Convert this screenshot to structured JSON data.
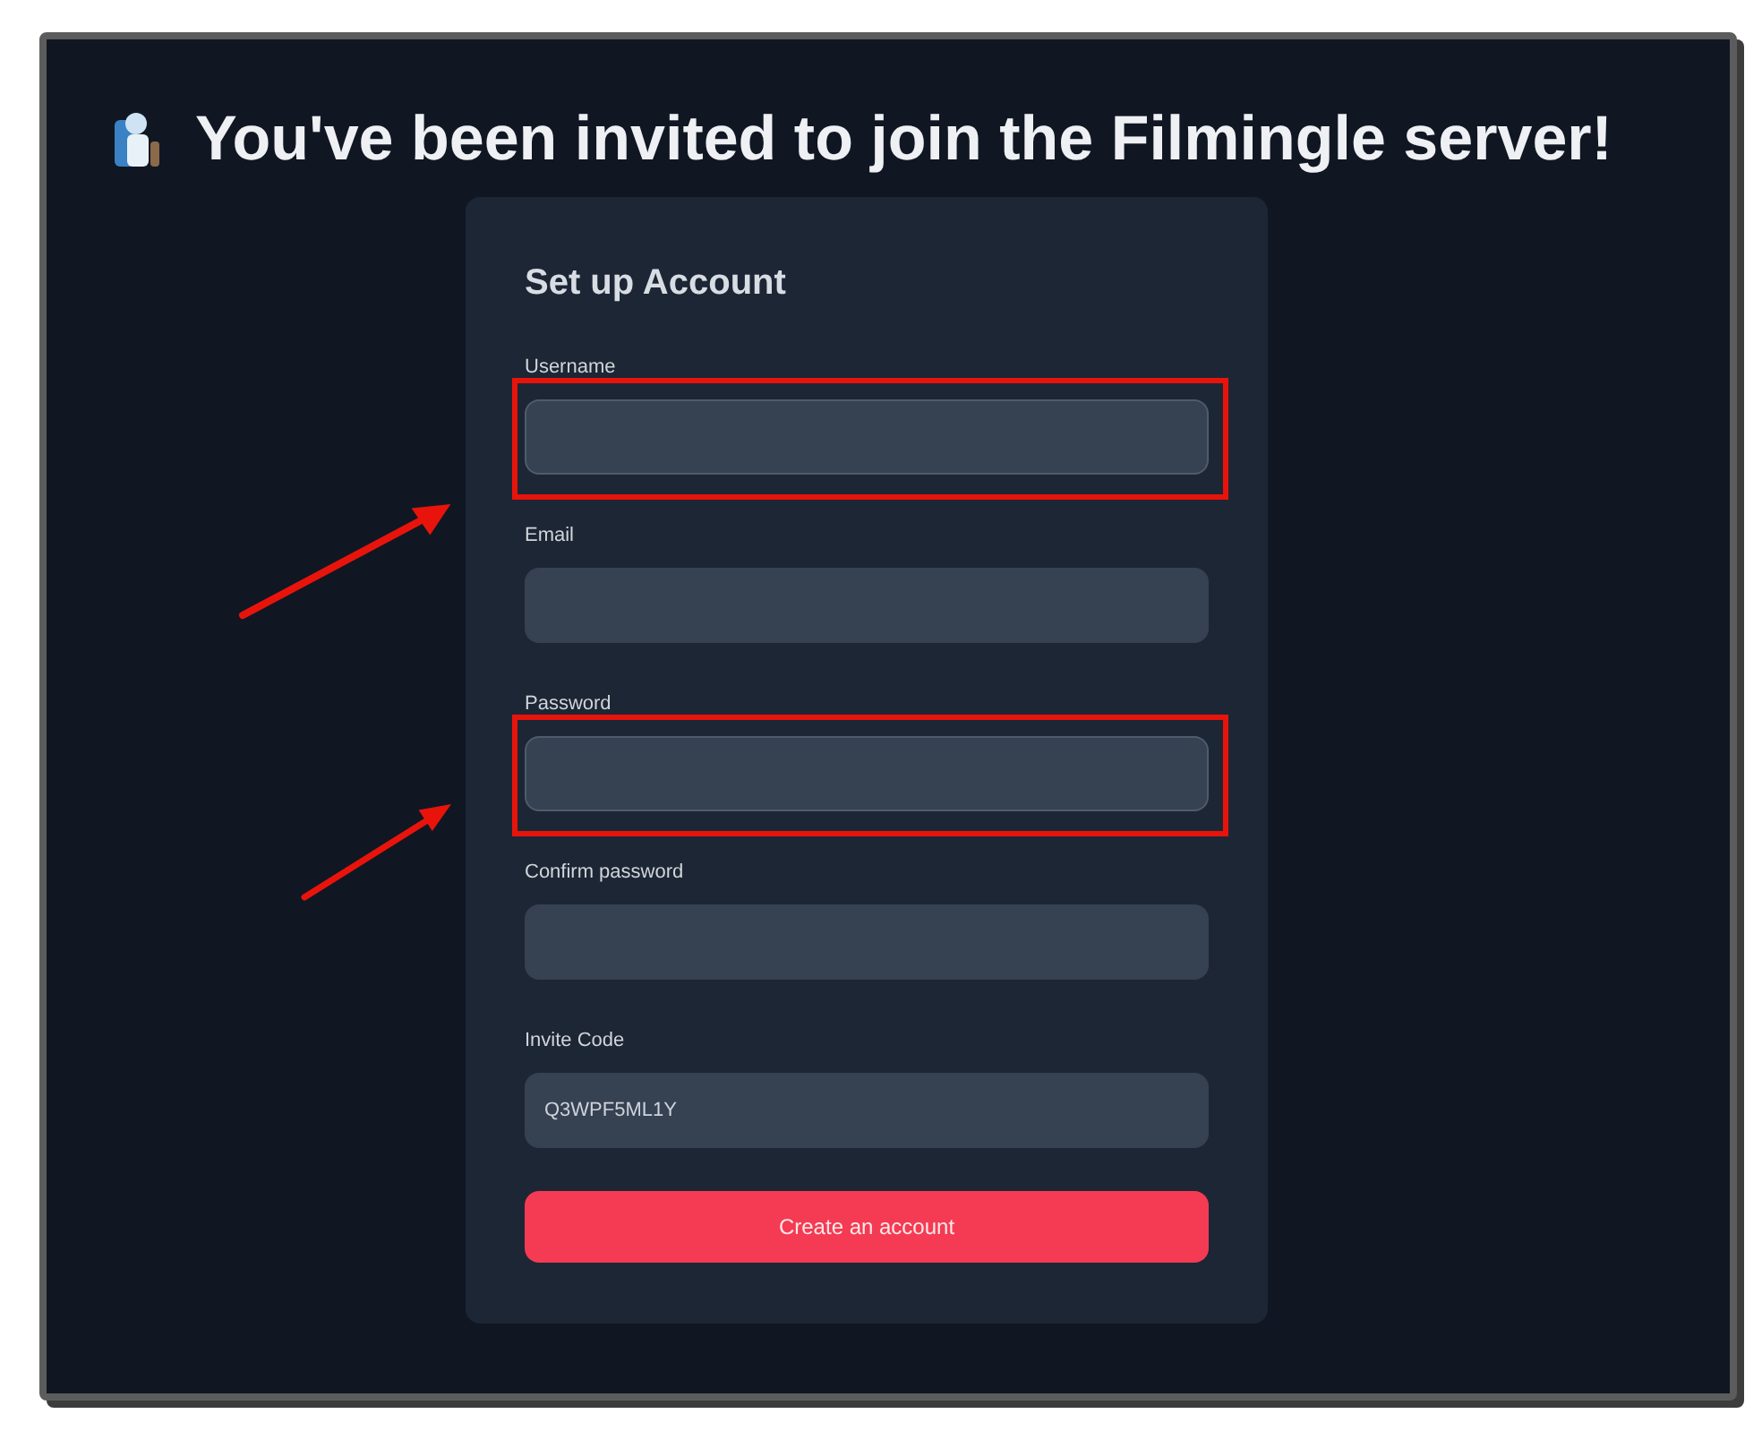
{
  "heading": {
    "text": "You've been invited to join the Filmingle server!"
  },
  "form": {
    "title": "Set up Account",
    "fields": [
      {
        "label": "Username",
        "highlighted": true
      },
      {
        "label": "Email",
        "highlighted": false
      },
      {
        "label": "Password",
        "highlighted": true
      },
      {
        "label": "Confirm password",
        "highlighted": false
      },
      {
        "label": "Invite Code",
        "value": "Q3WPF5ML1Y",
        "highlighted": false
      }
    ],
    "submit": {
      "label": "Create an account"
    }
  }
}
